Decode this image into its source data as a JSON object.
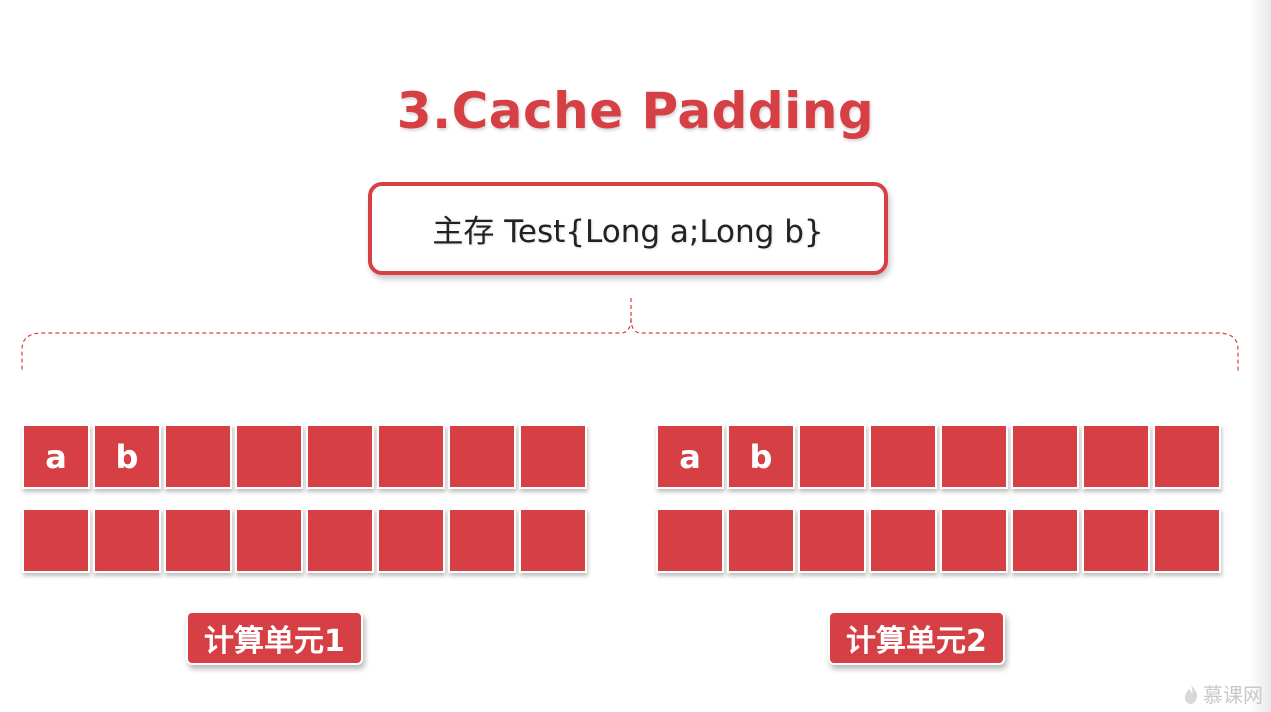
{
  "title": "3.Cache Padding",
  "main_memory": {
    "label": "主存 Test{Long a;Long b}"
  },
  "colors": {
    "accent": "#d64045",
    "text": "#222222"
  },
  "units": [
    {
      "label": "计算单元1",
      "rows": [
        [
          "a",
          "b",
          "",
          "",
          "",
          "",
          "",
          ""
        ],
        [
          "",
          "",
          "",
          "",
          "",
          "",
          "",
          ""
        ]
      ]
    },
    {
      "label": "计算单元2",
      "rows": [
        [
          "a",
          "b",
          "",
          "",
          "",
          "",
          "",
          ""
        ],
        [
          "",
          "",
          "",
          "",
          "",
          "",
          "",
          ""
        ]
      ]
    }
  ],
  "watermark": {
    "text": "慕课网",
    "icon": "flame-icon"
  }
}
